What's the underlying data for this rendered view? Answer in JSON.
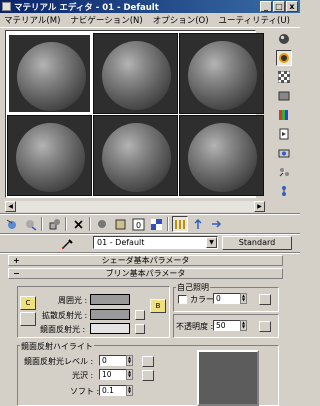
{
  "window": {
    "title": "マテリアル エディタ - 01 - Default",
    "minimize": "_",
    "maximize": "□",
    "close": "x"
  },
  "menu": [
    "マテリアル(M)",
    "ナビゲーション(N)",
    "オプション(O)",
    "ユーティリティ(U)"
  ],
  "material": {
    "picker_icon": "eyedropper-icon",
    "name": "01 - Default",
    "type_button": "Standard"
  },
  "rollouts": {
    "shader": "シェーダ基本パラメータ",
    "blinn": "ブリン基本パラメータ"
  },
  "rollout_toggle": {
    "collapsed": "+",
    "expanded": "−"
  },
  "blinn": {
    "lock_label": "C",
    "ambient_label": "周囲光 :",
    "diffuse_label": "拡散反射光 :",
    "specular_label": "鏡面反射光 :",
    "map_lock_label": "B",
    "self_illum_group": "自己照明",
    "color_label": "カラー",
    "self_illum_value": "0",
    "opacity_label": "不透明度 :",
    "opacity_value": "50"
  },
  "highlights": {
    "group": "鏡面反射ハイライト",
    "level_label": "鏡面反射光レベル :",
    "level_value": "0",
    "gloss_label": "光沢 :",
    "gloss_value": "10",
    "soften_label": "ソフト :",
    "soften_value": "0.1"
  },
  "colors": {
    "ambient": "#9a9a9a",
    "diffuse": "#9a9a9a",
    "specular": "#e4e4e4",
    "preview": "#5c5c5c"
  }
}
